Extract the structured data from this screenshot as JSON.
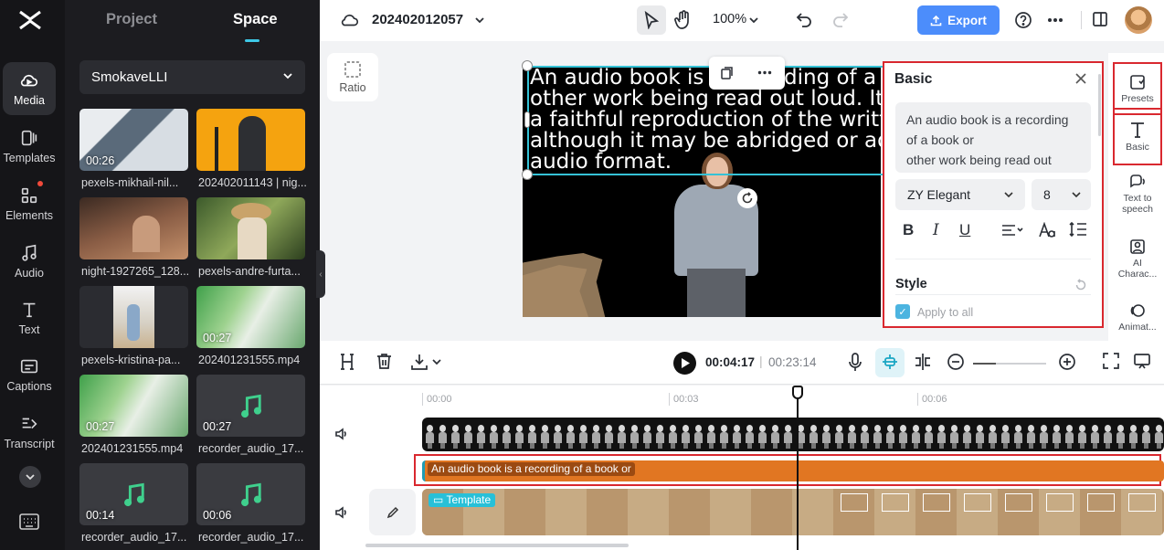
{
  "rail": {
    "items": [
      {
        "label": "Media",
        "icon": "cloud-media-icon"
      },
      {
        "label": "Templates",
        "icon": "templates-icon"
      },
      {
        "label": "Elements",
        "icon": "elements-icon"
      },
      {
        "label": "Audio",
        "icon": "music-note-icon"
      },
      {
        "label": "Text",
        "icon": "text-t-icon"
      },
      {
        "label": "Captions",
        "icon": "captions-icon"
      },
      {
        "label": "Transcript",
        "icon": "transcript-icon"
      }
    ]
  },
  "media": {
    "tabs": [
      "Project",
      "Space"
    ],
    "active_tab": "Space",
    "space_name": "SmokaveLLI",
    "items": [
      {
        "label": "pexels-mikhail-nil...",
        "duration": "00:26"
      },
      {
        "label": "202402011143 | nig...",
        "duration": ""
      },
      {
        "label": "night-1927265_128...",
        "duration": ""
      },
      {
        "label": "pexels-andre-furta...",
        "duration": ""
      },
      {
        "label": "pexels-kristina-pa...",
        "duration": ""
      },
      {
        "label": "202401231555.mp4",
        "duration": "00:27"
      },
      {
        "label": "202401231555.mp4",
        "duration": "00:27"
      },
      {
        "label": "recorder_audio_17...",
        "duration": "00:27"
      },
      {
        "label": "recorder_audio_17...",
        "duration": "00:14"
      },
      {
        "label": "recorder_audio_17...",
        "duration": "00:06"
      }
    ]
  },
  "topbar": {
    "project_name": "202402012057",
    "zoom": "100%",
    "export_label": "Export"
  },
  "canvas": {
    "ratio_label": "Ratio",
    "overlay_lines": [
      "An audio book is a recording of a book or",
      "other work being read out loud. It is",
      "a faithful reproduction of the written",
      "although it may be abridged or adapted",
      "audio format."
    ]
  },
  "basic": {
    "title": "Basic",
    "text_lines": [
      "An audio book is a recording",
      "of a book or",
      "other work being read out"
    ],
    "font": "ZY Elegant",
    "size": "8",
    "format_icons": [
      "B",
      "I",
      "U"
    ],
    "style_label": "Style",
    "apply_all_label": "Apply to all",
    "apply_all_checked": true
  },
  "right_tabs": [
    {
      "label": "Presets",
      "icon": "presets-icon"
    },
    {
      "label": "Basic",
      "icon": "text-t-icon"
    },
    {
      "label": "Text to speech",
      "icon": "text-to-speech-icon"
    },
    {
      "label": "AI Charac...",
      "icon": "ai-character-icon"
    },
    {
      "label": "Animat...",
      "icon": "animation-icon"
    }
  ],
  "playback": {
    "current_time": "00:04:17",
    "separator": "|",
    "total_time": "00:23:14"
  },
  "timeline": {
    "ruler": [
      "00:00",
      "00:03",
      "00:06"
    ],
    "text_clip_label": "An audio book is a recording of a book or",
    "template_label": "Template"
  },
  "colors": {
    "accent": "#4c8dfb",
    "selection": "#35c2d6",
    "highlight_border": "#d9282f",
    "text_clip": "#e17622"
  }
}
